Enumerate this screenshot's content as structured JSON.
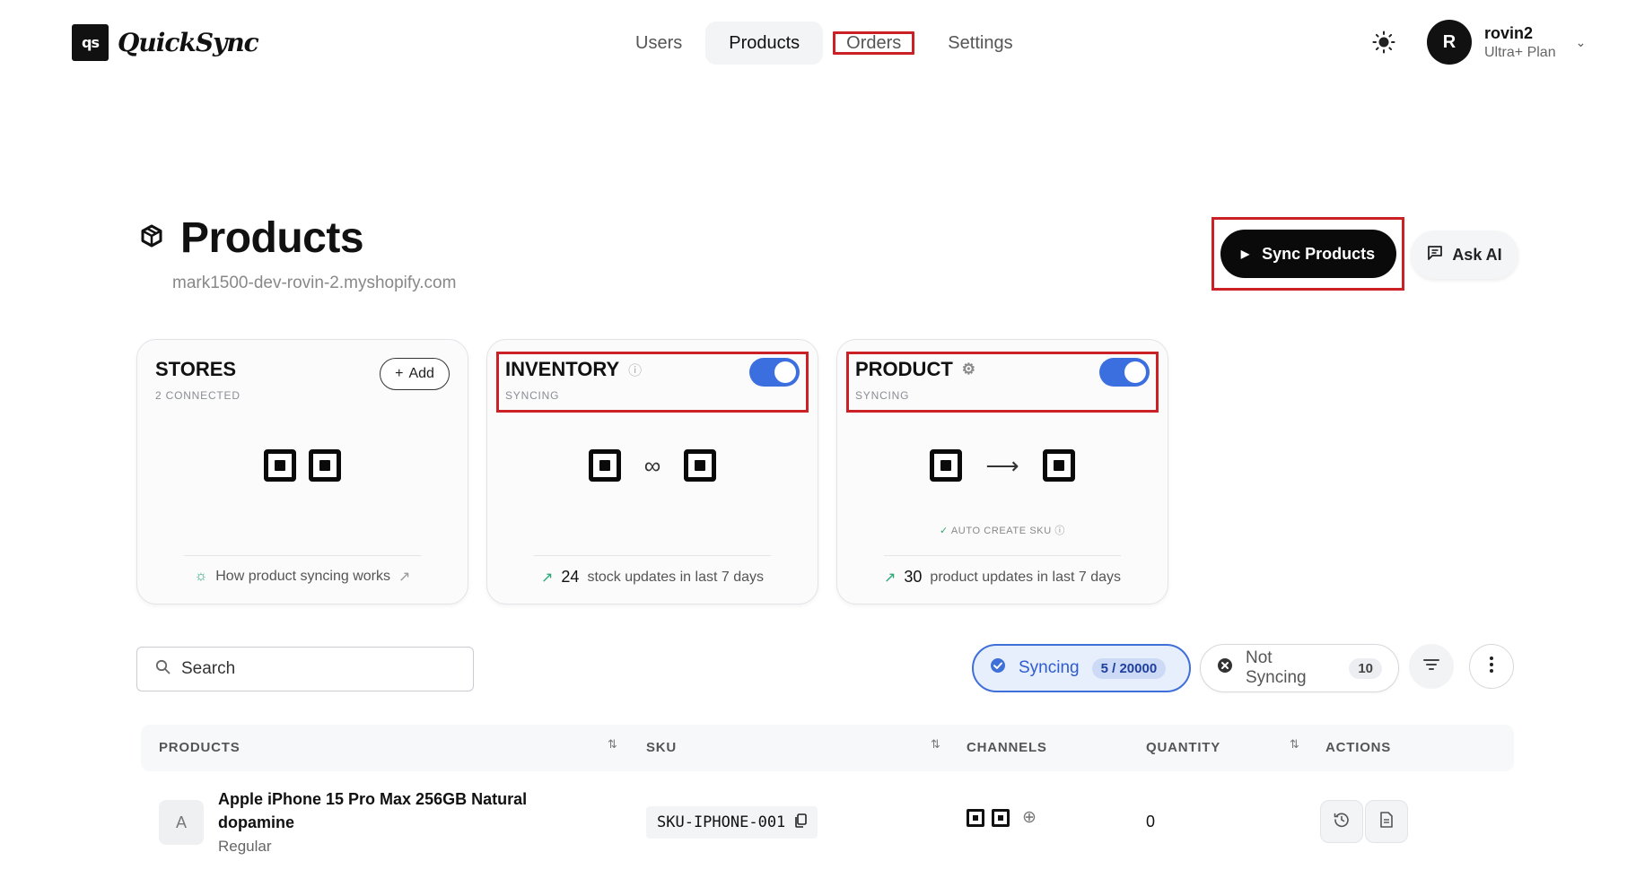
{
  "brand": {
    "mark": "qs",
    "name": "QuickSync"
  },
  "nav": {
    "users": "Users",
    "products": "Products",
    "orders": "Orders",
    "settings": "Settings"
  },
  "user": {
    "initial": "R",
    "name": "rovin2",
    "plan": "Ultra+ Plan"
  },
  "page": {
    "title": "Products",
    "store_url": "mark1500-dev-rovin-2.myshopify.com"
  },
  "actions": {
    "sync_products": "Sync Products",
    "ask_ai": "Ask AI"
  },
  "cards": {
    "stores": {
      "title": "STORES",
      "sub": "2 CONNECTED",
      "add": "Add",
      "footer": "How product syncing works"
    },
    "inventory": {
      "title": "INVENTORY",
      "sub": "SYNCING",
      "count": "24",
      "footer": "stock updates in last 7 days"
    },
    "product": {
      "title": "PRODUCT",
      "sub": "SYNCING",
      "auto_sku": "AUTO CREATE SKU",
      "count": "30",
      "footer": "product updates in last 7 days"
    }
  },
  "filters": {
    "search_placeholder": "Search",
    "syncing_label": "Syncing",
    "syncing_count": "5 / 20000",
    "not_syncing_label": "Not Syncing",
    "not_syncing_count": "10"
  },
  "table": {
    "headers": {
      "products": "PRODUCTS",
      "sku": "SKU",
      "channels": "CHANNELS",
      "quantity": "QUANTITY",
      "actions": "ACTIONS"
    },
    "rows": [
      {
        "initial": "A",
        "name": "Apple iPhone 15 Pro Max 256GB Natural dopamine",
        "type": "Regular",
        "sku": "SKU-IPHONE-001",
        "quantity": "0"
      }
    ]
  },
  "colors": {
    "accent": "#3b6fe0",
    "highlight": "#cc2027",
    "trend": "#2aa876"
  }
}
